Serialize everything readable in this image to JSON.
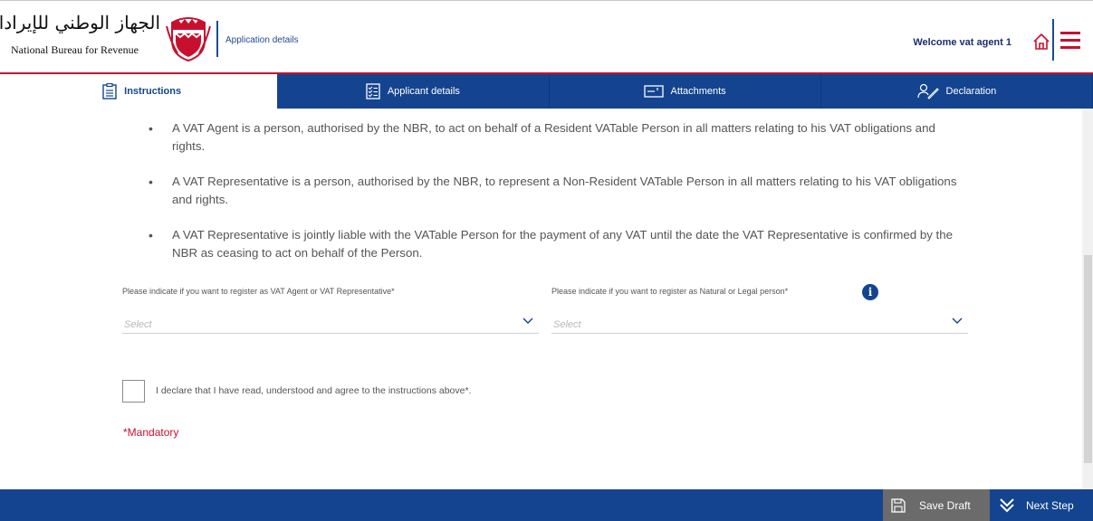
{
  "header": {
    "logo_arabic": "الجهاز الوطني للإيرادات",
    "logo_english": "National Bureau for Revenue",
    "app_title": "Application details",
    "welcome_text": "Welcome vat agent 1",
    "home_icon": "home-icon",
    "menu_icon": "hamburger-menu-icon"
  },
  "tabs": [
    {
      "label": "Instructions",
      "icon": "clipboard-icon",
      "active": true
    },
    {
      "label": "Applicant details",
      "icon": "checklist-icon",
      "active": false
    },
    {
      "label": "Attachments",
      "icon": "card-icon",
      "active": false
    },
    {
      "label": "Declaration",
      "icon": "signature-icon",
      "active": false
    }
  ],
  "instructions": [
    "A VAT Agent is a person, authorised by the NBR, to act on behalf of a Resident VATable Person in all matters relating to his VAT obligations and rights.",
    "A VAT Representative is a person, authorised by the NBR, to represent a Non-Resident VATable Person in all matters relating to his VAT obligations and rights.",
    "A VAT Representative is jointly liable with the VATable Person for the payment of any VAT until the date the VAT Representative is confirmed by the NBR as ceasing to act on behalf of the Person."
  ],
  "form": {
    "agent_type_label": "Please indicate if you want to register as VAT Agent or VAT Representative*",
    "agent_type_value": "Select",
    "person_type_label": "Please indicate if you want to register as Natural or Legal person*",
    "person_type_value": "Select",
    "info_icon_glyph": "i",
    "declaration_text": "I declare that I have read, understood and agree to the instructions above*.",
    "declaration_checked": false,
    "mandatory_note": "*Mandatory"
  },
  "footer": {
    "save_draft_label": "Save Draft",
    "next_step_label": "Next Step"
  },
  "colors": {
    "brand_blue": "#14448f",
    "brand_red": "#c8102e",
    "save_gray": "#6b6b6b"
  }
}
